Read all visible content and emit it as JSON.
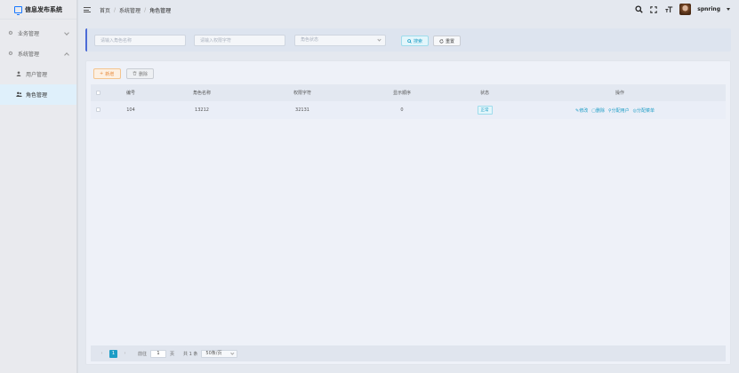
{
  "app": {
    "title": "信息发布系统"
  },
  "sidebar": {
    "items": [
      {
        "label": "业务管理",
        "icon": "gear-icon"
      },
      {
        "label": "系统管理",
        "icon": "gear-icon"
      },
      {
        "label": "用户管理",
        "icon": "user-icon"
      },
      {
        "label": "角色管理",
        "icon": "users-icon"
      }
    ]
  },
  "header": {
    "breadcrumb": [
      "首页",
      "系统管理",
      "角色管理"
    ],
    "username": "spnring",
    "icons": [
      "search-icon",
      "fullscreen-icon",
      "font-size-icon"
    ]
  },
  "search": {
    "role_name_placeholder": "请输入角色名称",
    "permission_placeholder": "请输入权限字符",
    "status_placeholder": "角色状态",
    "search_label": "搜索",
    "reset_label": "重置"
  },
  "toolbar": {
    "add_label": "新增",
    "delete_label": "删除"
  },
  "table": {
    "columns": [
      "编号",
      "角色名称",
      "权限字符",
      "显示顺序",
      "状态",
      "操作"
    ],
    "rows": [
      {
        "id": "104",
        "name": "13212",
        "key": "32131",
        "order": "0",
        "status": "正常",
        "actions": [
          "修改",
          "删除",
          "分配用户",
          "分配菜单"
        ]
      }
    ]
  },
  "pagination": {
    "current": "1",
    "goto_label": "前往",
    "goto_value": "1",
    "page_suffix": "页",
    "total": "共 1 条",
    "page_size": "50条/页"
  },
  "colors": {
    "accent": "#1d9dc6",
    "warning": "#e6893a",
    "brand": "#1677ff"
  }
}
